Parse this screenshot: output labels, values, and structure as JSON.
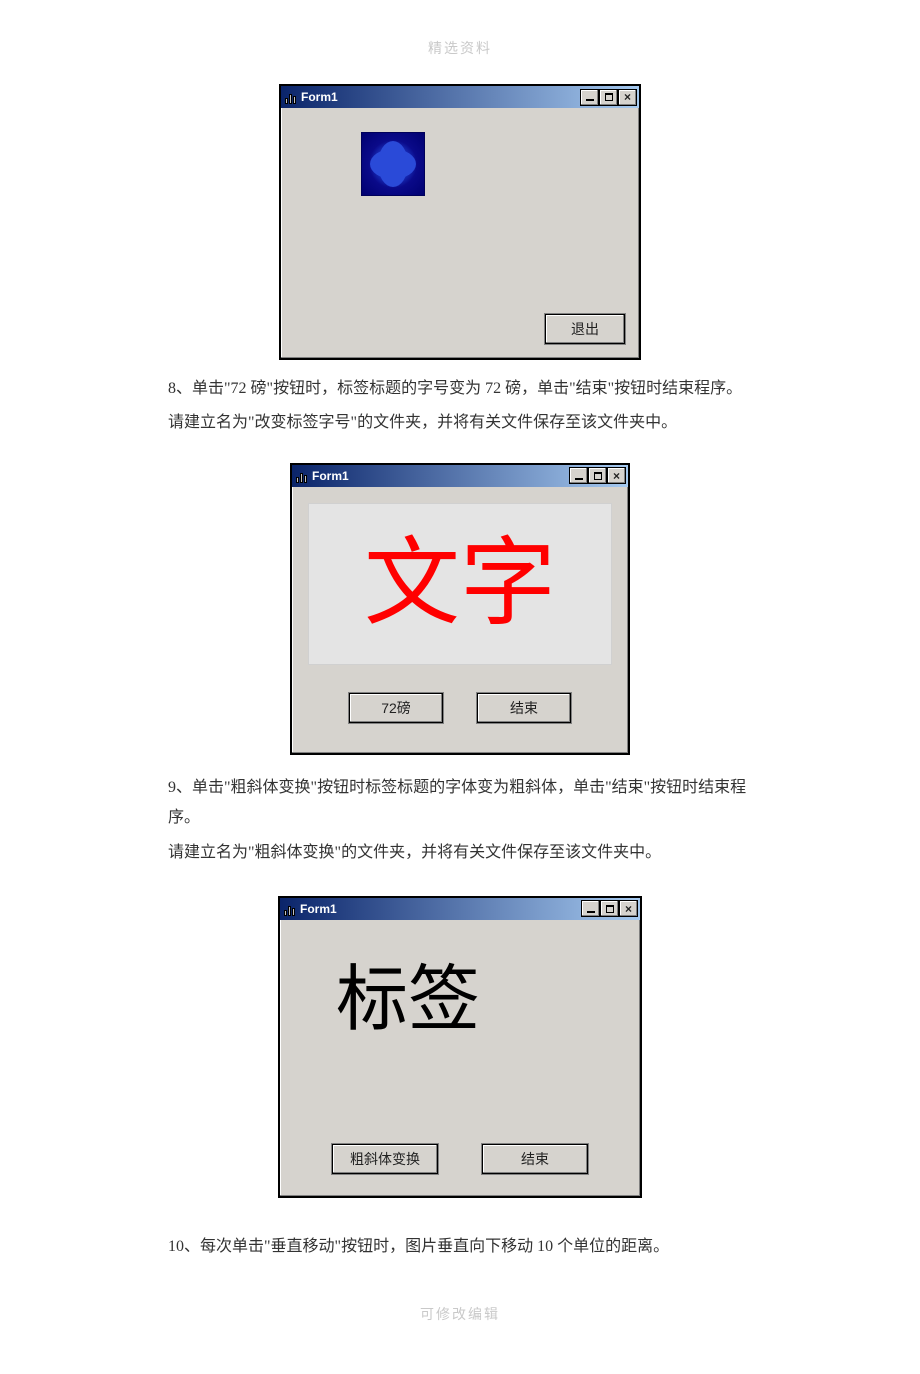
{
  "header": "精选资料",
  "footer": "可修改编辑",
  "windows": {
    "w1": {
      "title": "Form1",
      "exit_label": "退出"
    },
    "w2": {
      "title": "Form1",
      "big_text": "文字",
      "btn_72": "72磅",
      "btn_end": "结束"
    },
    "w3": {
      "title": "Form1",
      "label_text": "标签",
      "btn_bold_italic": "粗斜体变换",
      "btn_end": "结束"
    }
  },
  "paragraphs": {
    "p8a": "8、单击\"72 磅\"按钮时，标签标题的字号变为 72 磅，单击\"结束\"按钮时结束程序。",
    "p8b": "请建立名为\"改变标签字号\"的文件夹，并将有关文件保存至该文件夹中。",
    "p9a": "9、单击\"粗斜体变换\"按钮时标签标题的字体变为粗斜体，单击\"结束\"按钮时结束程序。",
    "p9b": "请建立名为\"粗斜体变换\"的文件夹，并将有关文件保存至该文件夹中。",
    "p10": "10、每次单击\"垂直移动\"按钮时，图片垂直向下移动 10 个单位的距离。"
  }
}
